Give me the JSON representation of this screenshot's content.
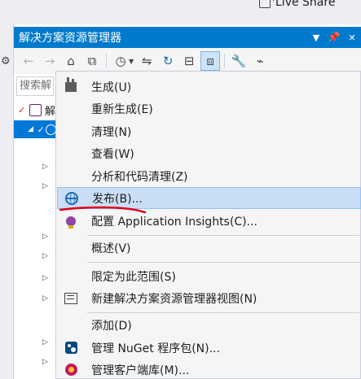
{
  "live_share": {
    "label": "Live Share"
  },
  "panel": {
    "title": "解决方案资源管理器",
    "search_placeholder": "搜索解",
    "solution_label": "解"
  },
  "toolbar": {
    "buttons": [
      {
        "name": "back-icon",
        "glyph": "⊖",
        "enabled": false
      },
      {
        "name": "forward-icon",
        "glyph": "⊕",
        "enabled": false
      },
      {
        "name": "home-icon",
        "glyph": "⌂",
        "enabled": true
      },
      {
        "name": "vs-switch-views-icon",
        "glyph": "⧉",
        "enabled": true
      },
      {
        "name": "pending-changes-filter-icon",
        "glyph": "◔",
        "enabled": true
      },
      {
        "name": "sync-active-document-icon",
        "glyph": "⇋",
        "enabled": true
      },
      {
        "name": "refresh-icon",
        "glyph": "↻",
        "enabled": true
      },
      {
        "name": "collapse-all-icon",
        "glyph": "⊟",
        "enabled": true
      },
      {
        "name": "show-all-files-icon",
        "glyph": "⧈",
        "enabled": true,
        "active": true
      },
      {
        "name": "properties-wrench-icon",
        "glyph": "🔧",
        "enabled": true
      },
      {
        "name": "preview-selected-items-icon",
        "glyph": "▭",
        "enabled": true
      }
    ]
  },
  "context_menu": {
    "items": [
      {
        "label": "生成(U)",
        "icon": "build-icon"
      },
      {
        "label": "重新生成(E)",
        "icon": ""
      },
      {
        "label": "清理(N)",
        "icon": ""
      },
      {
        "label": "查看(W)",
        "icon": ""
      },
      {
        "label": "分析和代码清理(Z)",
        "icon": ""
      },
      {
        "label": "发布(B)...",
        "icon": "publish-globe-icon",
        "highlighted": true
      },
      {
        "label": "配置 Application Insights(C)...",
        "icon": "application-insights-icon"
      },
      {
        "label": "概述(V)",
        "icon": ""
      },
      {
        "label": "限定为此范围(S)",
        "icon": ""
      },
      {
        "label": "新建解决方案资源管理器视图(N)",
        "icon": "new-view-icon"
      },
      {
        "label": "添加(D)",
        "icon": ""
      },
      {
        "label": "管理 NuGet 程序包(N)...",
        "icon": "nuget-icon"
      },
      {
        "label": "管理客户端库(M)...",
        "icon": "client-library-icon"
      }
    ]
  },
  "colors": {
    "accent": "#007acc",
    "selection": "#0078d7",
    "menu_highlight": "#c9def5",
    "annotation": "#e0001b"
  }
}
